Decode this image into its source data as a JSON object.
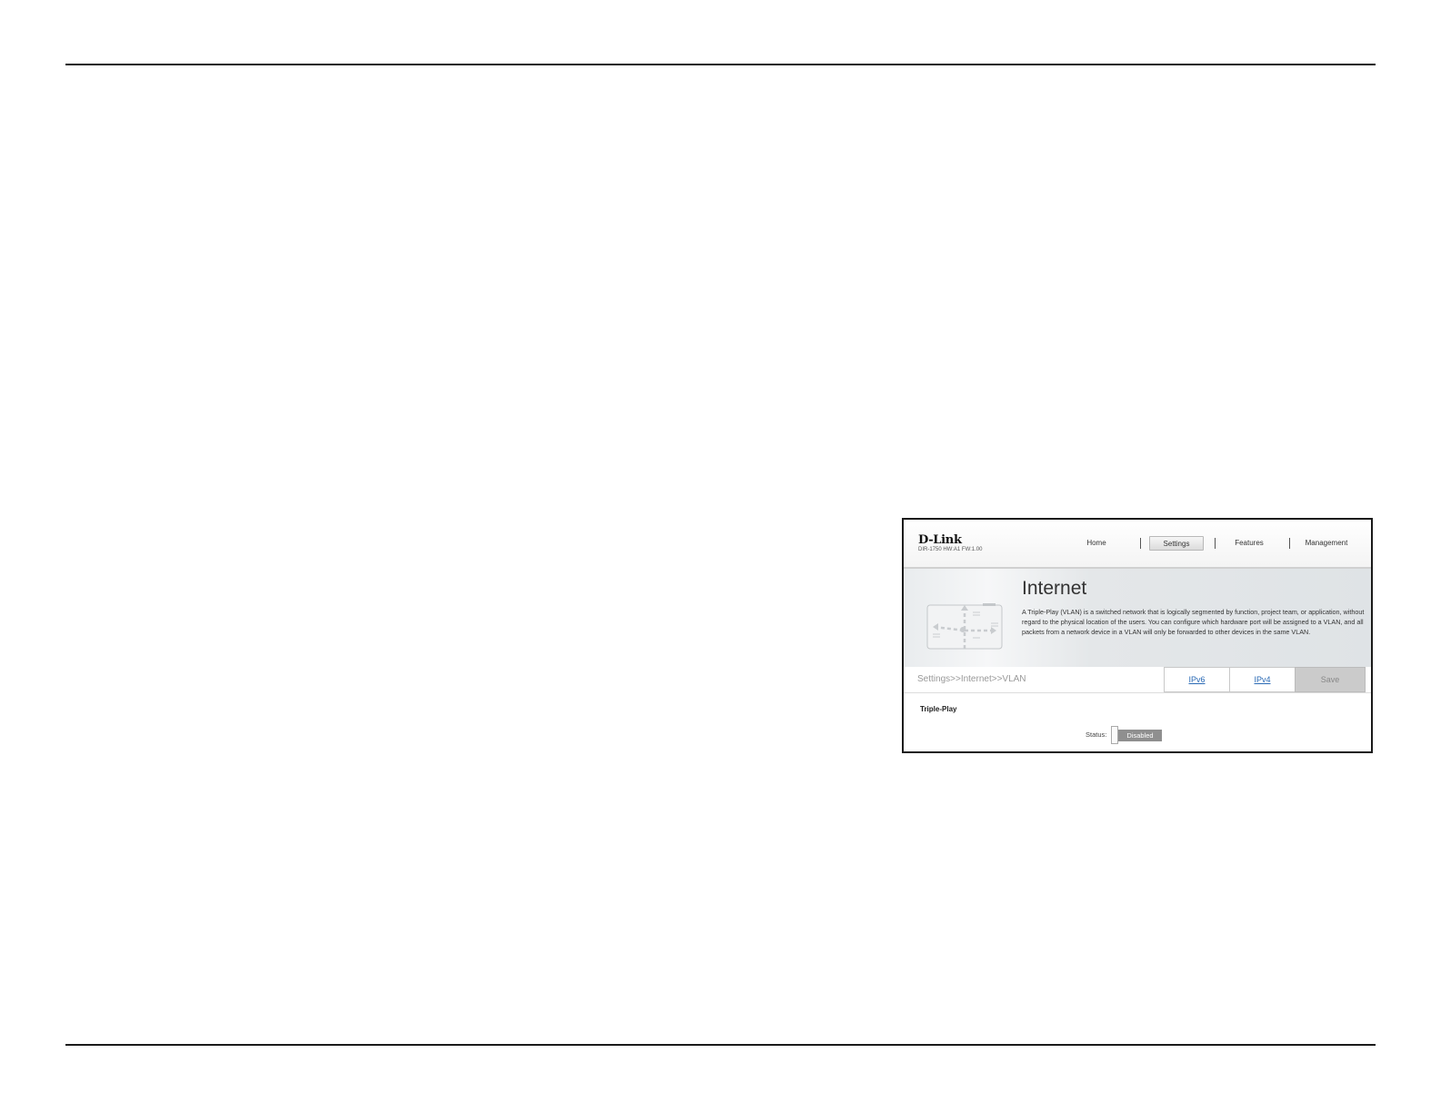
{
  "router_ui": {
    "brand": "D-Link",
    "model_info": "DIR-1750 HW:A1 FW:1.00",
    "nav": [
      {
        "label": "Home",
        "active": false
      },
      {
        "label": "Settings",
        "active": true
      },
      {
        "label": "Features",
        "active": false
      },
      {
        "label": "Management",
        "active": false
      }
    ],
    "banner": {
      "title": "Internet",
      "description": "A Triple-Play (VLAN) is a switched network that is logically segmented by function, project team, or application, without regard to the physical location of the users. You can configure which hardware port will be assigned to a VLAN, and all packets from a network device in a VLAN will only be forwarded to other devices in the same VLAN."
    },
    "breadcrumb": "Settings>>Internet>>VLAN",
    "buttons": {
      "ipv6": "IPv6",
      "ipv4": "IPv4",
      "save": "Save"
    },
    "section": {
      "title": "Triple-Play",
      "status_label": "Status:",
      "status_value": "Disabled"
    }
  },
  "colors": {
    "link": "#2a6ab5",
    "toggle_off": "#8f8f8f",
    "save_disabled": "#cbcbcb"
  }
}
